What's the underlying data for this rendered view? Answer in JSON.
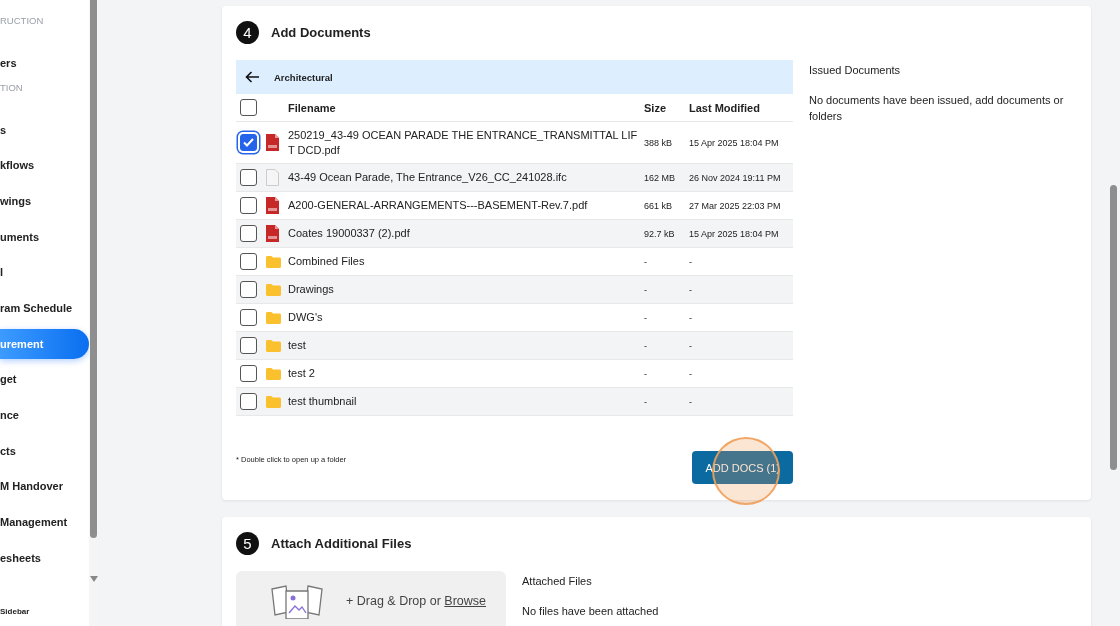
{
  "sidebar": {
    "groups": [
      {
        "label": "RUCTION",
        "items": [
          {
            "label": "ers",
            "selected": false
          }
        ]
      },
      {
        "label": "TION",
        "items": [
          {
            "label": "s",
            "selected": false
          },
          {
            "label": "kflows",
            "selected": false
          },
          {
            "label": "wings",
            "selected": false
          },
          {
            "label": "uments",
            "selected": false
          },
          {
            "label": "l",
            "selected": false
          },
          {
            "label": "ram Schedule",
            "selected": false
          },
          {
            "label": "urement",
            "selected": true
          },
          {
            "label": "get",
            "selected": false
          },
          {
            "label": "nce",
            "selected": false
          },
          {
            "label": "cts",
            "selected": false
          },
          {
            "label": "M Handover",
            "selected": false
          },
          {
            "label": "Management",
            "selected": false
          },
          {
            "label": "esheets",
            "selected": false
          }
        ]
      }
    ],
    "footer": "Sidebar"
  },
  "add_documents": {
    "step": "4",
    "title": "Add Documents",
    "folder": "Architectural",
    "columns": [
      "Filename",
      "Size",
      "Last Modified"
    ],
    "select_all_checked": false,
    "rows": [
      {
        "kind": "pdf",
        "name": "250219_43-49 OCEAN PARADE THE ENTRANCE_TRANSMITTAL LIFT DCD.pdf",
        "size": "388 kB",
        "modified": "15 Apr 2025 18:04 PM",
        "checked": true
      },
      {
        "kind": "file",
        "name": "43-49 Ocean Parade, The Entrance_V26_CC_241028.ifc",
        "size": "162 MB",
        "modified": "26 Nov 2024 19:11 PM",
        "checked": false
      },
      {
        "kind": "pdf",
        "name": "A200-GENERAL-ARRANGEMENTS---BASEMENT-Rev.7.pdf",
        "size": "661 kB",
        "modified": "27 Mar 2025 22:03 PM",
        "checked": false
      },
      {
        "kind": "pdf",
        "name": "Coates 19000337 (2).pdf",
        "size": "92.7 kB",
        "modified": "15 Apr 2025 18:04 PM",
        "checked": false
      },
      {
        "kind": "folder",
        "name": "Combined Files",
        "size": "-",
        "modified": "-",
        "checked": false
      },
      {
        "kind": "folder",
        "name": "Drawings",
        "size": "-",
        "modified": "-",
        "checked": false
      },
      {
        "kind": "folder",
        "name": "DWG's",
        "size": "-",
        "modified": "-",
        "checked": false
      },
      {
        "kind": "folder",
        "name": "test",
        "size": "-",
        "modified": "-",
        "checked": false
      },
      {
        "kind": "folder",
        "name": "test 2",
        "size": "-",
        "modified": "-",
        "checked": false
      },
      {
        "kind": "folder",
        "name": "test thumbnail",
        "size": "-",
        "modified": "-",
        "checked": false
      }
    ],
    "hint": "* Double click to open up a folder",
    "button": "ADD DOCS (1)",
    "click_marker": true,
    "issued_title": "Issued Documents",
    "issued_empty": "No documents have been issued, add documents or folders"
  },
  "attach_files": {
    "step": "5",
    "title": "Attach Additional Files",
    "drop_prefix": "+ Drag & Drop or",
    "browse": "Browse",
    "attached_title": "Attached Files",
    "attached_empty": "No files have been attached"
  }
}
